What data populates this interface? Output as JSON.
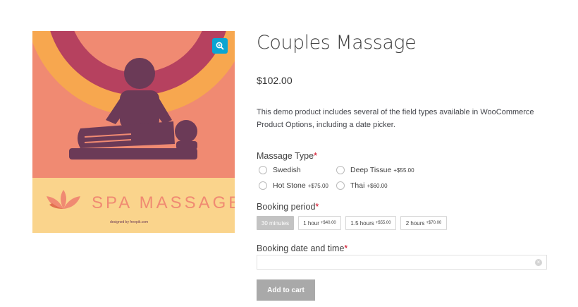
{
  "product": {
    "title": "Couples Massage",
    "price": "$102.00",
    "description": "This demo product includes several of the field types available in WooCommerce Product Options, including a date picker."
  },
  "image": {
    "banner_text": "SPA MASSAGE",
    "credit_text": "designed by freepik.com",
    "zoom_icon": "zoom-in-icon",
    "colors": {
      "background": "#f08a72",
      "band": "#fad48c",
      "figure": "#6b3a57",
      "arc_outer": "#b6415f",
      "arc_inner": "#f7a74f",
      "zoom_button": "#0aa5d2"
    }
  },
  "massage_type": {
    "label": "Massage Type",
    "required_mark": "*",
    "options": [
      {
        "label": "Swedish",
        "extra": ""
      },
      {
        "label": "Deep Tissue",
        "extra": "+$55.00"
      },
      {
        "label": "Hot Stone",
        "extra": "+$75.00"
      },
      {
        "label": "Thai",
        "extra": "+$60.00"
      }
    ]
  },
  "booking_period": {
    "label": "Booking period",
    "required_mark": "*",
    "options": [
      {
        "label": "30 minutes",
        "extra": "",
        "selected": true
      },
      {
        "label": "1 hour",
        "extra": "+$40.00",
        "selected": false
      },
      {
        "label": "1.5 hours",
        "extra": "+$55.00",
        "selected": false
      },
      {
        "label": "2 hours",
        "extra": "+$70.00",
        "selected": false
      }
    ]
  },
  "booking_date": {
    "label": "Booking date and time",
    "required_mark": "*",
    "value": "",
    "clear_icon": "clear-icon"
  },
  "cart": {
    "add_label": "Add to cart",
    "button_color": "#a9a9a9"
  }
}
